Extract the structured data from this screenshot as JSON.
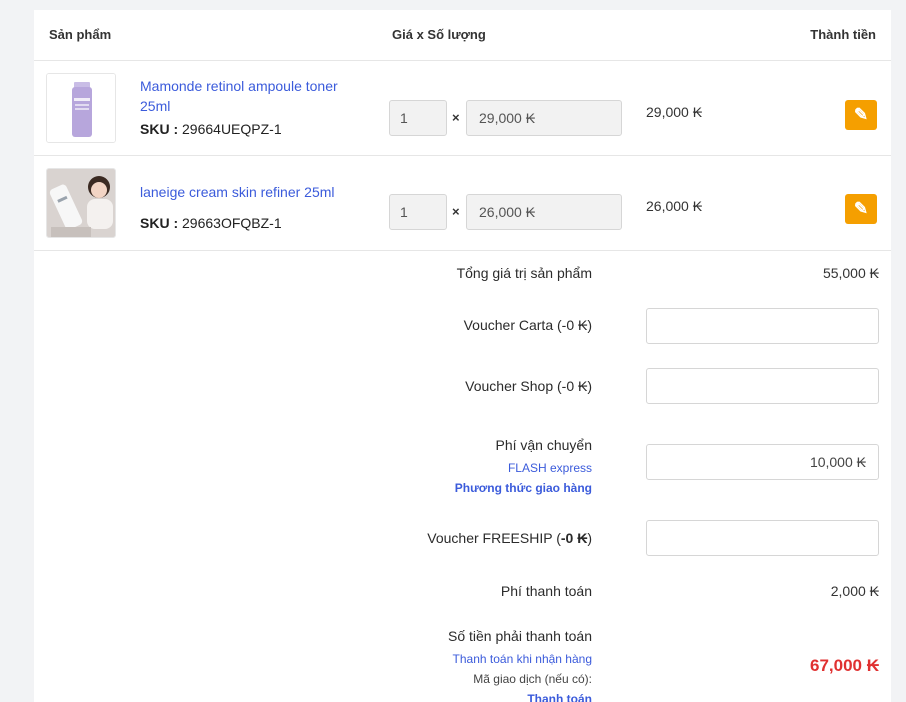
{
  "header": {
    "product": "Sản phẩm",
    "price_qty": "Giá x Số lượng",
    "total": "Thành tiền"
  },
  "products": [
    {
      "name": "Mamonde retinol ampoule toner 25ml",
      "sku_label": "SKU :",
      "sku": "29664UEQPZ-1",
      "qty": "1",
      "unit_price": "29,000 ₭",
      "line_total": "29,000 ₭"
    },
    {
      "name": "laneige cream skin refiner 25ml",
      "sku_label": "SKU :",
      "sku": "29663OFQBZ-1",
      "qty": "1",
      "unit_price": "26,000 ₭",
      "line_total": "26,000 ₭"
    }
  ],
  "times_symbol": "×",
  "summary": {
    "subtotal_label": "Tổng giá trị sản phẩm",
    "subtotal_value": "55,000 ₭",
    "voucher_carta_label": "Voucher Carta (-0 ₭)",
    "voucher_shop_label": "Voucher Shop (-0 ₭)",
    "shipping_label": "Phí vận chuyển",
    "shipping_carrier": "FLASH express",
    "shipping_method_link": "Phương thức giao hàng",
    "shipping_value": "10,000 ₭",
    "freeship_prefix": "Voucher FREESHIP (",
    "freeship_amount": "-0 ₭",
    "freeship_suffix": ")",
    "payment_fee_label": "Phí thanh toán",
    "payment_fee_value": "2,000 ₭",
    "total_label": "Số tiền phải thanh toán",
    "payment_method": "Thanh toán khi nhận hàng",
    "transaction_code_label": "Mã giao dịch (nếu có):",
    "pay_link": "Thanh toán",
    "total_value": "67,000 ₭"
  },
  "colors": {
    "link": "#3b5bdb",
    "action_button": "#f59f00",
    "total_red": "#e03131"
  },
  "icons": {
    "action": "feather-icon"
  }
}
